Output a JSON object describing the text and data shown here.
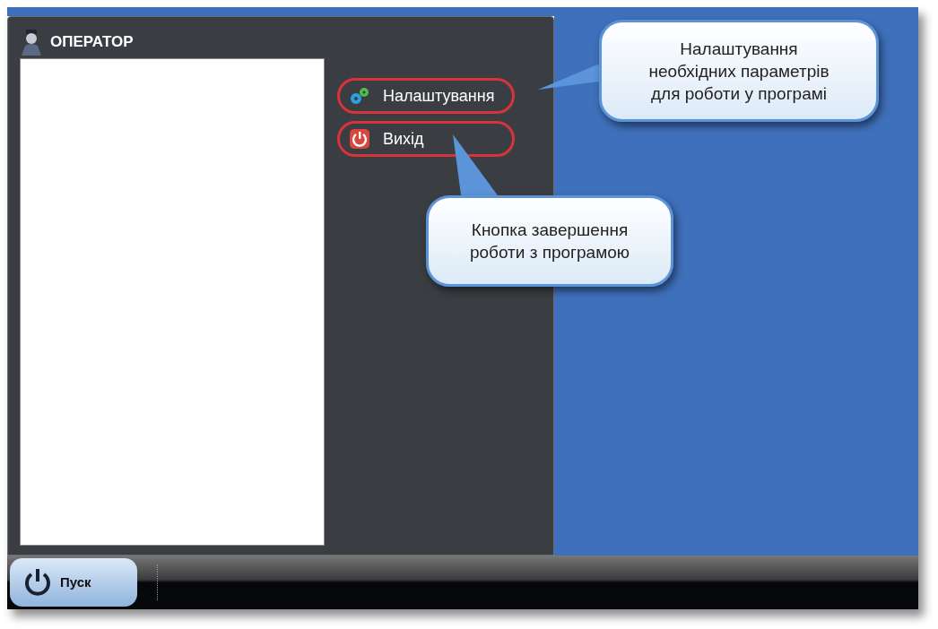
{
  "menu": {
    "title": "ОПЕРАТОР",
    "items": [
      {
        "label": "Налаштування",
        "kind": "settings",
        "highlighted": true
      },
      {
        "label": "Вихід",
        "kind": "exit",
        "highlighted": true
      }
    ]
  },
  "callouts": [
    {
      "lines": [
        "Налаштування",
        "необхідних параметрів",
        "для роботи у програмі"
      ]
    },
    {
      "lines": [
        "Кнопка завершення",
        "роботи з програмою"
      ]
    }
  ],
  "taskbar": {
    "start_button": "Пуск"
  }
}
